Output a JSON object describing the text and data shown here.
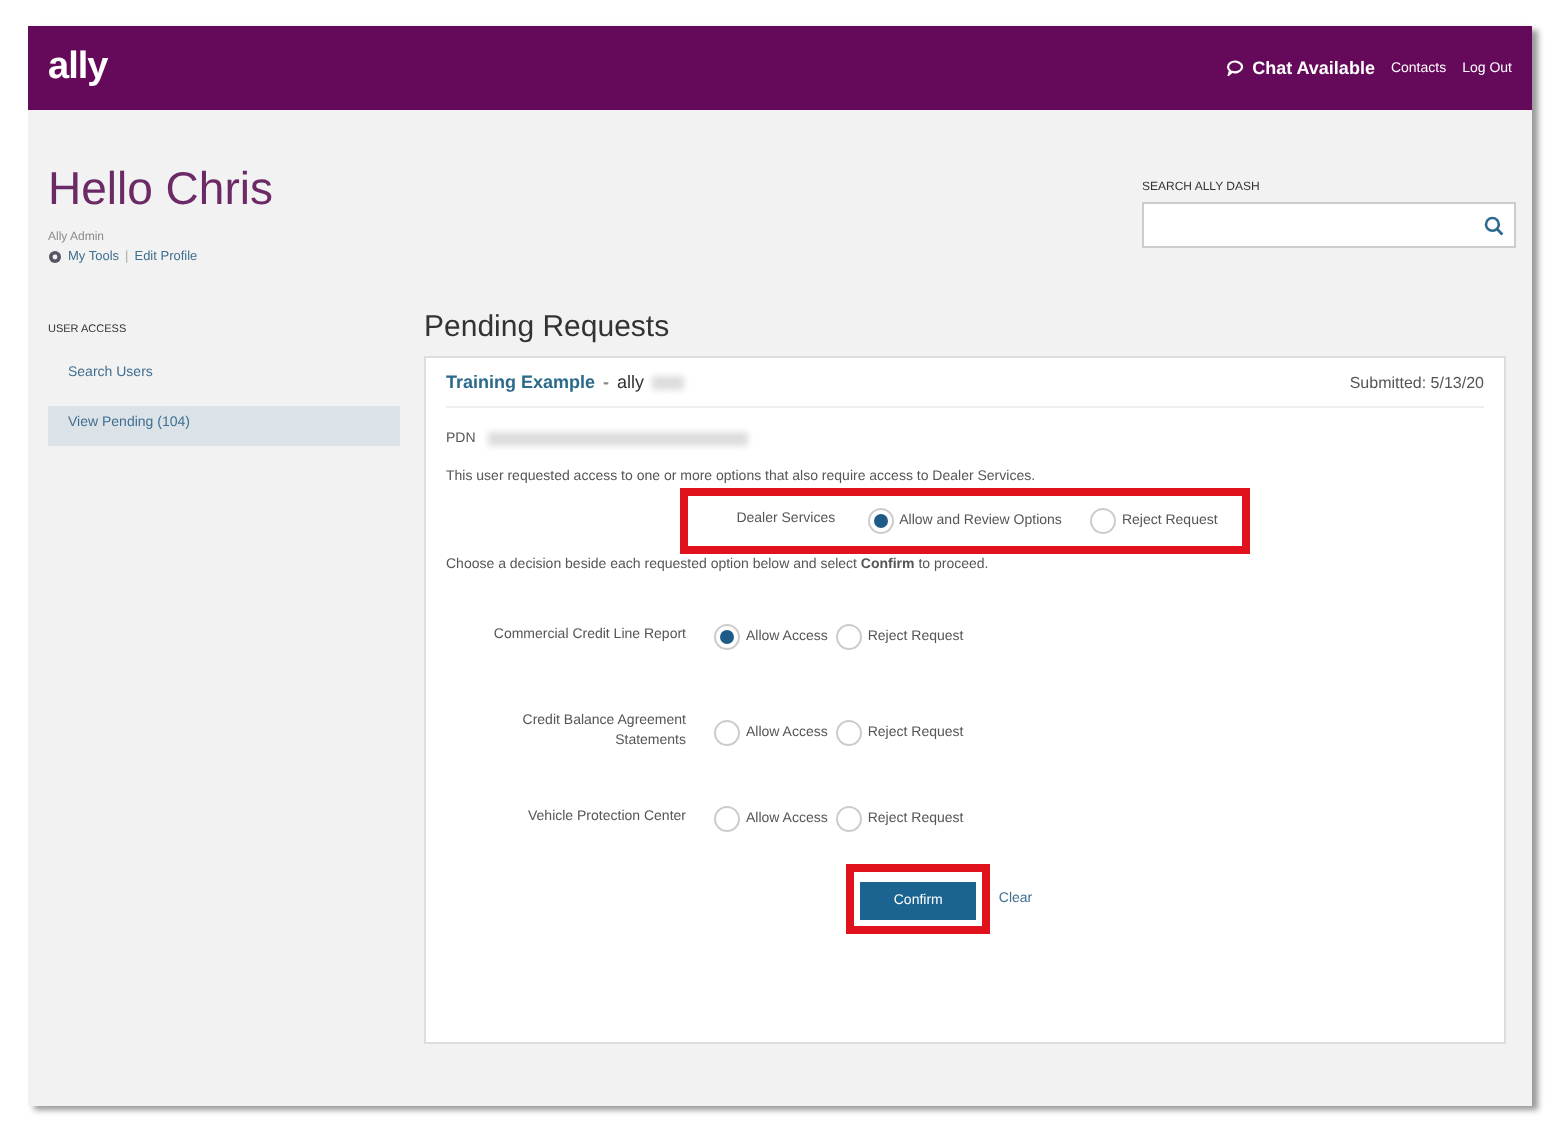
{
  "header": {
    "logo": "ally",
    "links": [
      {
        "kind": "chat",
        "label": "Chat Available"
      },
      {
        "kind": "link",
        "label": "Contacts"
      },
      {
        "kind": "link",
        "label": "Log Out"
      }
    ]
  },
  "greeting": "Hello Chris",
  "role": "Ally Admin",
  "profile_links": [
    "My Tools",
    "Edit Profile"
  ],
  "profile_separator": "|",
  "search": {
    "label": "SEARCH ALLY DASH"
  },
  "sidebar": {
    "heading": "USER ACCESS",
    "items": [
      {
        "label": "Search Users",
        "selected": false
      },
      {
        "label": "View Pending (104)",
        "selected": true
      }
    ]
  },
  "main": {
    "title": "Pending Requests",
    "request": {
      "name": "Training Example",
      "separator": "-",
      "user": "ally",
      "submitted": "Submitted: 5/13/20",
      "pdn_label": "PDN",
      "intro": "This user requested access to one or more options that also require access to Dealer Services.",
      "dealer": {
        "label": "Dealer Services",
        "highlighted": true,
        "choices": [
          {
            "label": "Allow and Review Options",
            "selected": true
          },
          {
            "label": "Reject Request",
            "selected": false
          }
        ]
      },
      "instruction": "Choose a decision beside each requested option below and select **Confirm** to proceed.",
      "options": [
        {
          "label": "Commercial Credit Line Report",
          "choices": [
            {
              "label": "Allow Access",
              "selected": true
            },
            {
              "label": "Reject Request",
              "selected": false
            }
          ]
        },
        {
          "label": "Credit Balance Agreement Statements",
          "choices": [
            {
              "label": "Allow Access",
              "selected": false
            },
            {
              "label": "Reject Request",
              "selected": false
            }
          ]
        },
        {
          "label": "Vehicle Protection Center",
          "choices": [
            {
              "label": "Allow Access",
              "selected": false
            },
            {
              "label": "Reject Request",
              "selected": false
            }
          ]
        }
      ],
      "confirm": {
        "label": "Confirm",
        "highlighted": true
      },
      "clear": "Clear"
    }
  }
}
